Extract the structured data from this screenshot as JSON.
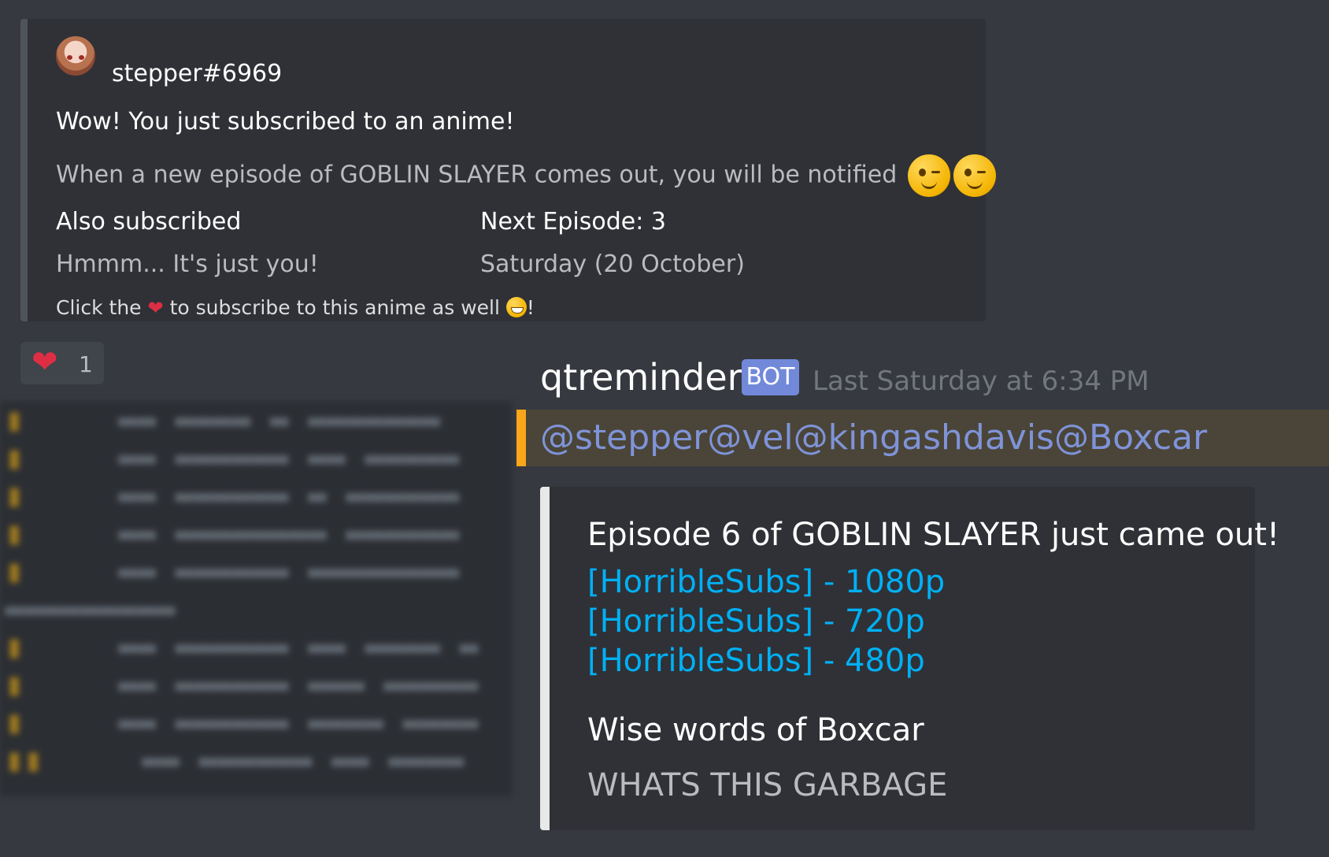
{
  "embed_top": {
    "author": "stepper#6969",
    "title": "Wow! You just subscribed to an anime!",
    "description": "When a new episode of GOBLIN SLAYER comes out, you will be notified",
    "fields": [
      {
        "name": "Also subscribed",
        "value": "Hmmm... It's just you!"
      },
      {
        "name": "Next Episode: 3",
        "value": "Saturday (20 October)"
      }
    ],
    "footer_before": "Click the",
    "footer_middle": "to subscribe to this anime as well",
    "footer_after": "!"
  },
  "reaction": {
    "emoji": "heart-icon",
    "count": "1"
  },
  "bot_message": {
    "username": "qtreminder",
    "tag": "BOT",
    "timestamp": "Last Saturday at 6:34 PM",
    "mentions": "@stepper@vel@kingashdavis@Boxcar",
    "embed": {
      "title": "Episode 6 of GOBLIN SLAYER just came out!",
      "links": [
        "[HorribleSubs] - 1080p",
        "[HorribleSubs] - 720p",
        "[HorribleSubs] - 480p"
      ],
      "field_name": "Wise words of Boxcar",
      "field_value": "WHATS THIS GARBAGE"
    }
  },
  "colors": {
    "background": "#36393f",
    "embed_bg": "#2f3136",
    "link": "#00b0f4",
    "bot_tag": "#7289da",
    "mention_highlight": "#faa61a"
  }
}
